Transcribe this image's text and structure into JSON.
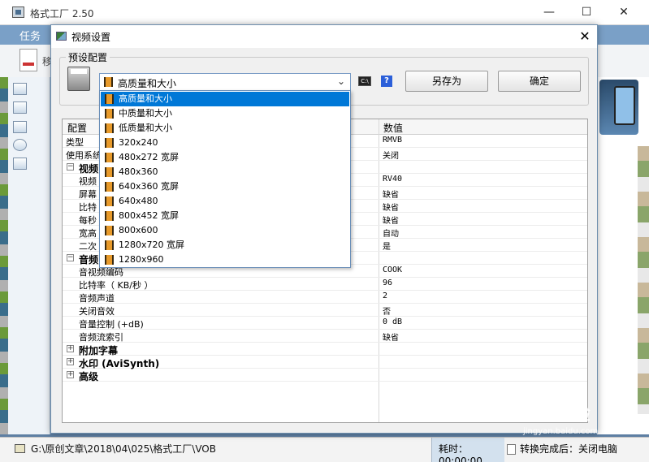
{
  "app": {
    "title": "格式工厂 2.50",
    "menu_task": "任务",
    "toolbar_label": "移",
    "window_controls": {
      "minimize": "—",
      "maximize": "☐",
      "close": "✕"
    }
  },
  "dialog": {
    "title": "视频设置",
    "close": "✕",
    "preset_group_label": "预设配置",
    "preset_selected": "高质量和大小",
    "save_as_label": "另存为",
    "ok_label": "确定",
    "help_label": "?",
    "cmd_label": "C:\\"
  },
  "dropdown": {
    "options": [
      "高质量和大小",
      "中质量和大小",
      "低质量和大小",
      "320x240",
      "480x272 宽屏",
      "480x360",
      "640x360 宽屏",
      "640x480",
      "800x452 宽屏",
      "800x600",
      "1280x720 宽屏",
      "1280x960"
    ],
    "selected_index": 0
  },
  "settings": {
    "headers": [
      "配置",
      "数值"
    ],
    "rows": [
      {
        "name": "类型",
        "value": "RMVB"
      },
      {
        "name": "使用系统",
        "value": "关闭"
      },
      {
        "name": "视频",
        "value": ""
      },
      {
        "name": "视频",
        "value": "RV40"
      },
      {
        "name": "屏幕",
        "value": "缺省"
      },
      {
        "name": "比特",
        "value": "缺省"
      },
      {
        "name": "每秒",
        "value": "缺省"
      },
      {
        "name": "宽高",
        "value": "自动"
      },
      {
        "name": "二次",
        "value": "是"
      },
      {
        "name": "音频",
        "value": ""
      },
      {
        "name": "音视频编码",
        "value": "COOK"
      },
      {
        "name": "比特率（ KB/秒 ）",
        "value": "96"
      },
      {
        "name": "音频声道",
        "value": "2"
      },
      {
        "name": "关闭音效",
        "value": "否"
      },
      {
        "name": "音量控制 (+dB)",
        "value": "0 dB"
      },
      {
        "name": "音频流索引",
        "value": "缺省"
      },
      {
        "name": "附加字幕",
        "value": ""
      },
      {
        "name": "水印 (AviSynth)",
        "value": ""
      },
      {
        "name": "高级",
        "value": ""
      }
    ]
  },
  "status": {
    "path": "G:\\原创文章\\2018\\04\\025\\格式工厂\\VOB",
    "elapsed": "耗时：00:00:00",
    "after_done": "转换完成后：关闭电脑"
  },
  "watermark": {
    "brand": "Baidu经验",
    "url": "jingyan.baidu.com"
  },
  "icons": {
    "app": "app-icon",
    "dialog": "video-settings-icon",
    "film": "film-icon",
    "help": "help-icon",
    "cmd": "command-prompt-icon",
    "folder": "folder-icon"
  },
  "colors": {
    "selection": "#0078d7",
    "menu_bar": "#7aa0c7",
    "status_highlight": "#d3e1ee"
  }
}
